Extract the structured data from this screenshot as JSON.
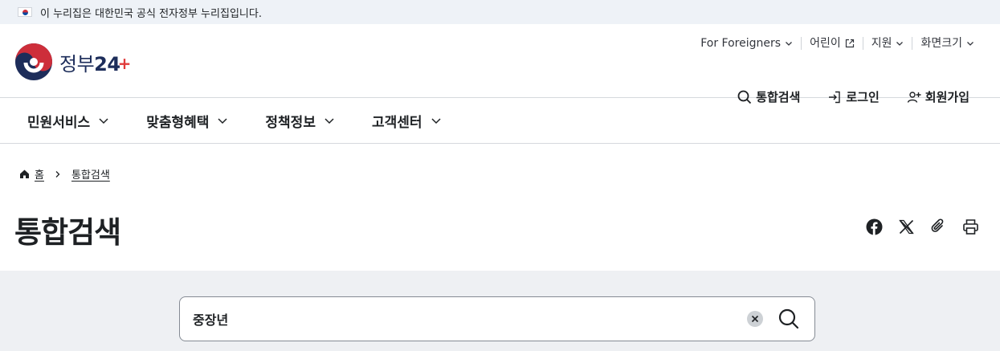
{
  "notice": {
    "text": "이 누리집은 대한민국 공식 전자정부 누리집입니다."
  },
  "logo": {
    "text": "정부",
    "number": "24"
  },
  "util_menu": [
    {
      "label": "For Foreigners",
      "icon": "chevron-down-icon"
    },
    {
      "label": "어린이",
      "icon": "external-link-icon"
    },
    {
      "label": "지원",
      "icon": "chevron-down-icon"
    },
    {
      "label": "화면크기",
      "icon": "chevron-down-icon"
    }
  ],
  "auth": {
    "search": "통합검색",
    "login": "로그인",
    "signup": "회원가입"
  },
  "gnb": [
    {
      "label": "민원서비스"
    },
    {
      "label": "맞춤형혜택"
    },
    {
      "label": "정책정보"
    },
    {
      "label": "고객센터"
    }
  ],
  "breadcrumb": {
    "home": "홈",
    "current": "통합검색"
  },
  "page_title": "통합검색",
  "search": {
    "value": "중장년"
  },
  "colors": {
    "brand_navy": "#1d2d5a",
    "brand_red": "#e03b3b",
    "notice_bg": "#eef2f7",
    "search_bg": "#eef0f3"
  }
}
